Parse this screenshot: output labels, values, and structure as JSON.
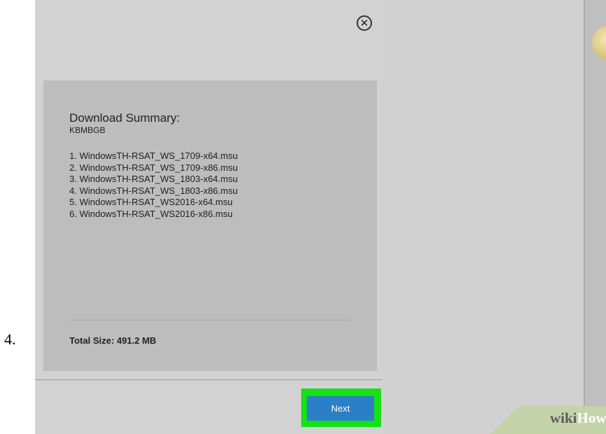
{
  "step_number": "4.",
  "dialog": {
    "close_symbol": "✕",
    "summary_title": "Download Summary:",
    "kb_id": "KBMBGB",
    "files": [
      "1. WindowsTH-RSAT_WS_1709-x64.msu",
      "2. WindowsTH-RSAT_WS_1709-x86.msu",
      "3. WindowsTH-RSAT_WS_1803-x64.msu",
      "4. WindowsTH-RSAT_WS_1803-x86.msu",
      "5. WindowsTH-RSAT_WS2016-x64.msu",
      "6. WindowsTH-RSAT_WS2016-x86.msu"
    ],
    "total_size": "Total Size: 491.2 MB",
    "next_label": "Next"
  },
  "watermark": {
    "part1": "wiki",
    "part2": "How"
  },
  "colors": {
    "highlight": "#16e016",
    "button": "#2b7fc6"
  }
}
